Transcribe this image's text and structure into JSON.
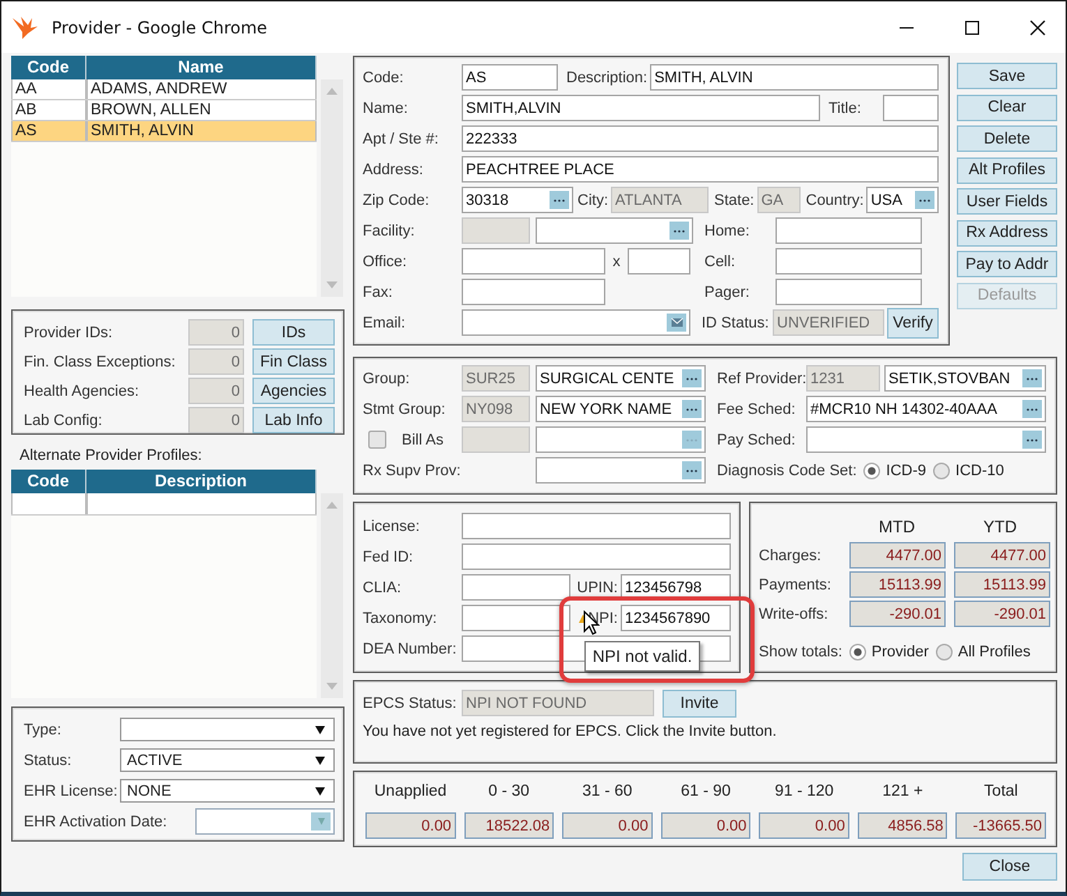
{
  "window": {
    "title": "Provider - Google Chrome"
  },
  "provider_list": {
    "columns": [
      "Code",
      "Name"
    ],
    "rows": [
      {
        "code": "AA",
        "name": "ADAMS, ANDREW",
        "selected": false
      },
      {
        "code": "AB",
        "name": "BROWN, ALLEN",
        "selected": false
      },
      {
        "code": "AS",
        "name": "SMITH, ALVIN",
        "selected": true
      }
    ]
  },
  "counts": [
    {
      "label": "Provider IDs:",
      "value": "0",
      "button": "IDs"
    },
    {
      "label": "Fin. Class Exceptions:",
      "value": "0",
      "button": "Fin Class"
    },
    {
      "label": "Health Agencies:",
      "value": "0",
      "button": "Agencies"
    },
    {
      "label": "Lab Config:",
      "value": "0",
      "button": "Lab Info"
    }
  ],
  "alternate_profiles": {
    "label": "Alternate Provider Profiles:",
    "columns": [
      "Code",
      "Description"
    ]
  },
  "provider_settings": [
    {
      "label": "Type:",
      "kind": "select"
    },
    {
      "label": "Status:",
      "value": "ACTIVE",
      "kind": "select"
    },
    {
      "label": "EHR License:",
      "value": "NONE",
      "kind": "select"
    },
    {
      "label": "EHR Activation Date:",
      "kind": "date"
    }
  ],
  "details": {
    "code": {
      "label": "Code:",
      "value": "AS"
    },
    "description": {
      "label": "Description:",
      "value": "SMITH, ALVIN"
    },
    "name": {
      "label": "Name:",
      "value": "SMITH,ALVIN"
    },
    "title": {
      "label": "Title:"
    },
    "apt": {
      "label": "Apt / Ste #:",
      "value": "222333"
    },
    "address": {
      "label": "Address:",
      "value": "PEACHTREE PLACE"
    },
    "zip": {
      "label": "Zip Code:",
      "value": "30318"
    },
    "city": {
      "label": "City:",
      "value": "ATLANTA"
    },
    "state": {
      "label": "State:",
      "value": "GA"
    },
    "country": {
      "label": "Country:",
      "value": "USA"
    },
    "facility": {
      "label": "Facility:"
    },
    "home": {
      "label": "Home:"
    },
    "office": {
      "label": "Office:",
      "ext_label": "x"
    },
    "cell": {
      "label": "Cell:"
    },
    "fax": {
      "label": "Fax:"
    },
    "pager": {
      "label": "Pager:"
    },
    "email": {
      "label": "Email:"
    },
    "id_status": {
      "label": "ID Status:",
      "value": "UNVERIFIED",
      "button": "Verify"
    }
  },
  "actions": [
    {
      "label": "Save",
      "disabled": false
    },
    {
      "label": "Clear",
      "disabled": false
    },
    {
      "label": "Delete",
      "disabled": false
    },
    {
      "label": "Alt Profiles",
      "disabled": false
    },
    {
      "label": "User Fields",
      "disabled": false
    },
    {
      "label": "Rx Address",
      "disabled": false
    },
    {
      "label": "Pay to Addr",
      "disabled": false
    },
    {
      "label": "Defaults",
      "disabled": true
    }
  ],
  "billing": {
    "group": {
      "label": "Group:",
      "code": "SUR25",
      "name": "SURGICAL CENTE"
    },
    "stmt_group": {
      "label": "Stmt Group:",
      "code": "NY098",
      "name": "NEW YORK NAME"
    },
    "bill_as": {
      "label": "Bill As",
      "checked": false
    },
    "rx_supv_prov": {
      "label": "Rx Supv Prov:"
    },
    "ref_provider": {
      "label": "Ref Provider:",
      "code": "1231",
      "name": "SETIK,STOVBAN"
    },
    "fee_sched": {
      "label": "Fee Sched:",
      "value": "#MCR10 NH 14302-40AAA"
    },
    "pay_sched": {
      "label": "Pay Sched:"
    },
    "diagnosis_code_set": {
      "label": "Diagnosis Code Set:",
      "options": [
        {
          "label": "ICD-9",
          "selected": true
        },
        {
          "label": "ICD-10",
          "selected": false
        }
      ]
    }
  },
  "identifiers": {
    "license": {
      "label": "License:"
    },
    "fed_id": {
      "label": "Fed ID:"
    },
    "clia": {
      "label": "CLIA:"
    },
    "upin": {
      "label": "UPIN:",
      "value": "123456798"
    },
    "taxonomy": {
      "label": "Taxonomy:"
    },
    "npi": {
      "label": "NPI:",
      "value": "1234567890",
      "warning": true
    },
    "dea": {
      "label": "DEA Number:"
    },
    "tooltip": "NPI not valid."
  },
  "totals": {
    "columns": [
      "MTD",
      "YTD"
    ],
    "rows": [
      {
        "label": "Charges:",
        "mtd": "4477.00",
        "ytd": "4477.00"
      },
      {
        "label": "Payments:",
        "mtd": "15113.99",
        "ytd": "15113.99"
      },
      {
        "label": "Write-offs:",
        "mtd": "-290.01",
        "ytd": "-290.01"
      }
    ],
    "show_totals": {
      "label": "Show totals:",
      "options": [
        {
          "label": "Provider",
          "selected": true
        },
        {
          "label": "All Profiles",
          "selected": false
        }
      ]
    }
  },
  "epcs": {
    "label": "EPCS Status:",
    "value": "NPI NOT FOUND",
    "button": "Invite",
    "message": "You have not yet registered for EPCS. Click the Invite button."
  },
  "aging": [
    {
      "label": "Unapplied",
      "value": "0.00"
    },
    {
      "label": "0 - 30",
      "value": "18522.08"
    },
    {
      "label": "31 - 60",
      "value": "0.00"
    },
    {
      "label": "61 - 90",
      "value": "0.00"
    },
    {
      "label": "91 - 120",
      "value": "0.00"
    },
    {
      "label": "121 +",
      "value": "4856.58"
    },
    {
      "label": "Total",
      "value": "-13665.50"
    }
  ],
  "close_button": "Close"
}
